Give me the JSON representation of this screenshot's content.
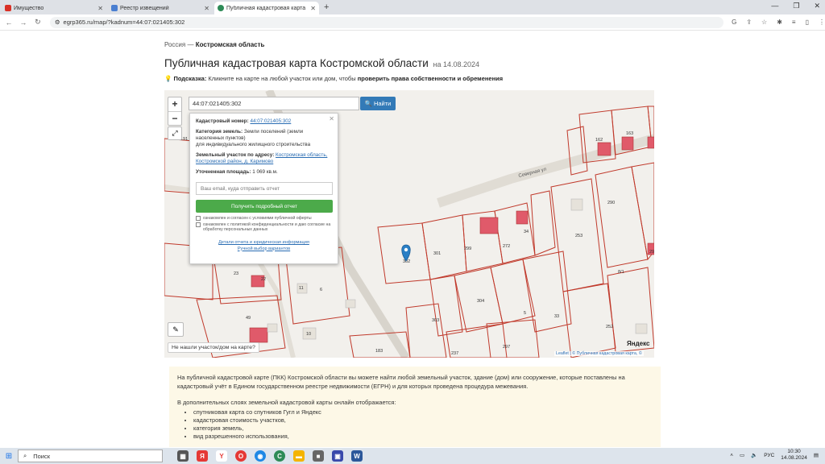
{
  "browser": {
    "tabs": [
      {
        "label": "Имущество",
        "favicon_color": "#d93025",
        "favicon_text": "РУС"
      },
      {
        "label": "Реестр извещений",
        "favicon_color": "#4a7fd1"
      },
      {
        "label": "Публичная кадастровая карта",
        "favicon_color": "#2e8b57",
        "active": true
      }
    ],
    "url": "egrp365.ru/map/?kadnum=44:07:021405:302"
  },
  "page": {
    "breadcrumb_root": "Россия",
    "breadcrumb_sep": "—",
    "breadcrumb_current": "Костромская область",
    "title": "Публичная кадастровая карта Костромской области",
    "title_date": "на 14.08.2024",
    "hint_label": "Подсказка:",
    "hint_text": "Кликните на карте на любой участок или дом, чтобы",
    "hint_bold": "проверить права собственности и обременения"
  },
  "map": {
    "search_value": "44:07:021405:302",
    "search_button": "Найти",
    "zoom_in": "+",
    "zoom_out": "−",
    "not_found": "Не нашли участок/дом на карте?",
    "attribution": "Leaflet | © Публичная кадастровая карта, ©",
    "yandex": "Яндекс",
    "street": "Северная ул",
    "parcel_labels": [
      "302",
      "301",
      "299",
      "272",
      "34",
      "253",
      "290",
      "162",
      "163",
      "303",
      "304",
      "297",
      "237",
      "183",
      "33",
      "5",
      "252",
      "8/1",
      "291",
      "11",
      "6",
      "10",
      "23",
      "49",
      "22",
      "191"
    ]
  },
  "popup": {
    "cadnum_label": "Кадастровый номер:",
    "cadnum_value": "44:07:021405:302",
    "category_label": "Категория земель:",
    "category_value": "Земли поселений (земли населенных пунктов)",
    "category_use": "для индивидуального жилищного строительства",
    "address_label": "Земельный участок по адресу:",
    "address_value": "Костромская область, Костромской район, д. Каримово",
    "area_label": "Уточненная площадь:",
    "area_value": "1 069 кв.м.",
    "email_placeholder": "Ваш email, куда отправить отчет",
    "report_button": "Получить подробный отчет",
    "check1": "ознакомлен и согласен с условиями публичной оферты",
    "check2": "ознакомлен с политикой конфиденциальности и даю согласие на обработку персональных данных",
    "link1": "Детали отчета и юридическая информация",
    "link2": "Ручной выбор вариантов"
  },
  "info": {
    "para1": "На публичной кадастровой карте (ПКК) Костромской области вы можете найти любой земельный участок, здание (дом) или сооружение, которые поставлены на кадастровый учёт в Едином государственном реестре недвижимости (ЕГРН) и для которых проведена процедура межевания.",
    "para2": "В дополнительных слоях земельной кадастровой карты онлайн отображается:",
    "items": [
      "спутниковая карта со спутников Гугл и Яндекс",
      "кадастровая стоимость участков,",
      "категория земель,",
      "вид разрешенного использования,"
    ]
  },
  "taskbar": {
    "search_label": "Поиск",
    "lang": "РУС",
    "time": "10:30",
    "date": "14.08.2024"
  }
}
